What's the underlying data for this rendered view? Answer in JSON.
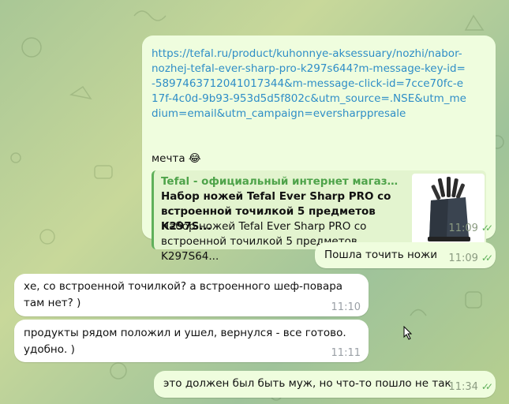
{
  "messages": [
    {
      "id": "m1",
      "direction": "outgoing",
      "link": "https://tefal.ru/product/kuhonnye-aksessuary/nozhi/nabor-nozhej-tefal-ever-sharp-pro-k297s644?m-message-key-id=-5897463712041017344&m-message-click-id=7cce70fc-e17f-4c0d-9b93-953d5d5f802c&utm_source=.NSE&utm_medium=email&utm_campaign=eversharppresale",
      "text": "мечта",
      "emoji": "😂",
      "preview": {
        "site": "Tefal - официальный интернет магазин б...",
        "title": "Набор ножей Tefal Ever Sharp PRO  со встроенной точилкой 5 предметов K297S...",
        "description": "Набор ножей Tefal Ever Sharp PRO  со встроенной точилкой 5 предметов K297S64..."
      },
      "time": "11:09",
      "status": "read"
    },
    {
      "id": "m2",
      "direction": "outgoing",
      "text": "Пошла точить ножи",
      "time": "11:09",
      "status": "read"
    },
    {
      "id": "m3",
      "direction": "incoming",
      "text": "хе, со встроенной точилкой? а встроенного шеф-повара там нет? )",
      "time": "11:10"
    },
    {
      "id": "m4",
      "direction": "incoming",
      "text": "продукты рядом положил и ушел, вернулся - все готово. удобно. )",
      "time": "11:11"
    },
    {
      "id": "m5",
      "direction": "outgoing",
      "text": "это должен был быть муж, но что-то пошло не так",
      "time": "11:34",
      "status": "read"
    }
  ],
  "ticks_glyph": "✓✓",
  "colors": {
    "outgoing_bubble": "#effdde",
    "incoming_bubble": "#ffffff",
    "link": "#2f8ec7",
    "accent_green": "#5fb05a"
  }
}
